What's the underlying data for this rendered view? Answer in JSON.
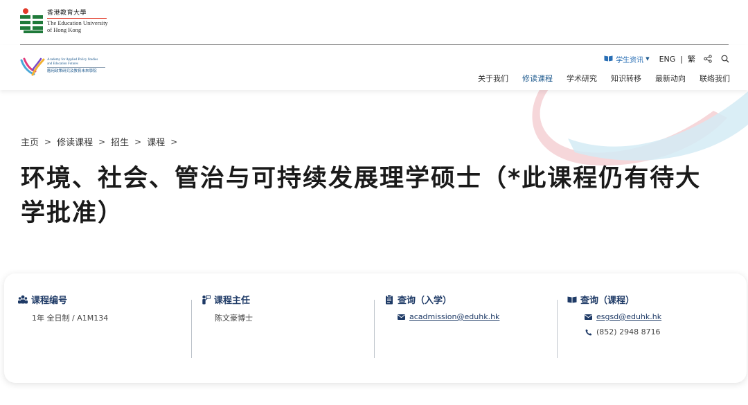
{
  "university": {
    "name_cn": "香港教育大學",
    "name_en_line1": "The Education University",
    "name_en_line2": "of Hong Kong",
    "logo_icon": "eduhk-logo-icon"
  },
  "academy": {
    "name_en_line1": "Academy for Applied Policy Studies",
    "name_en_line2": "and Education Futures",
    "name_cn": "應用政策研究及教育未來學院",
    "logo_icon": "apsef-logo-icon"
  },
  "utility": {
    "student_info": "学生资讯",
    "student_info_icon": "book-icon",
    "lang_eng": "ENG",
    "lang_sep": "|",
    "lang_trad": "繁",
    "share_icon": "share-icon",
    "search_icon": "search-icon"
  },
  "nav": {
    "items": [
      {
        "label": "关于我们"
      },
      {
        "label": "修读课程"
      },
      {
        "label": "学术研究"
      },
      {
        "label": "知识转移"
      },
      {
        "label": "最新动向"
      },
      {
        "label": "联络我们"
      }
    ],
    "active_index": 1
  },
  "breadcrumb": {
    "items": [
      "主页",
      "修读课程",
      "招生",
      "课程"
    ],
    "separator": ">"
  },
  "page": {
    "title": "环境、社会、管治与可持续发展理学硕士（*此课程仍有待大学批准）"
  },
  "info": {
    "code": {
      "heading": "课程编号",
      "icon": "people-icon",
      "value": "1年 全日制 / A1M134"
    },
    "leader": {
      "heading": "课程主任",
      "icon": "presenter-icon",
      "value": "陈文豪博士"
    },
    "admission": {
      "heading": "查询（入学）",
      "icon": "document-icon",
      "email": "acadmission@eduhk.hk"
    },
    "programme": {
      "heading": "查询（课程）",
      "icon": "book-icon",
      "email": "esgsd@eduhk.hk",
      "phone": "(852) 2948 8716"
    }
  },
  "colors": {
    "brand_green": "#1f7a3a",
    "brand_red": "#e23a2a",
    "brand_navy": "#1e3a66",
    "link_blue": "#2a6fb5",
    "arc_red": "#f3c7cc",
    "arc_blue": "#cfe8f3"
  }
}
